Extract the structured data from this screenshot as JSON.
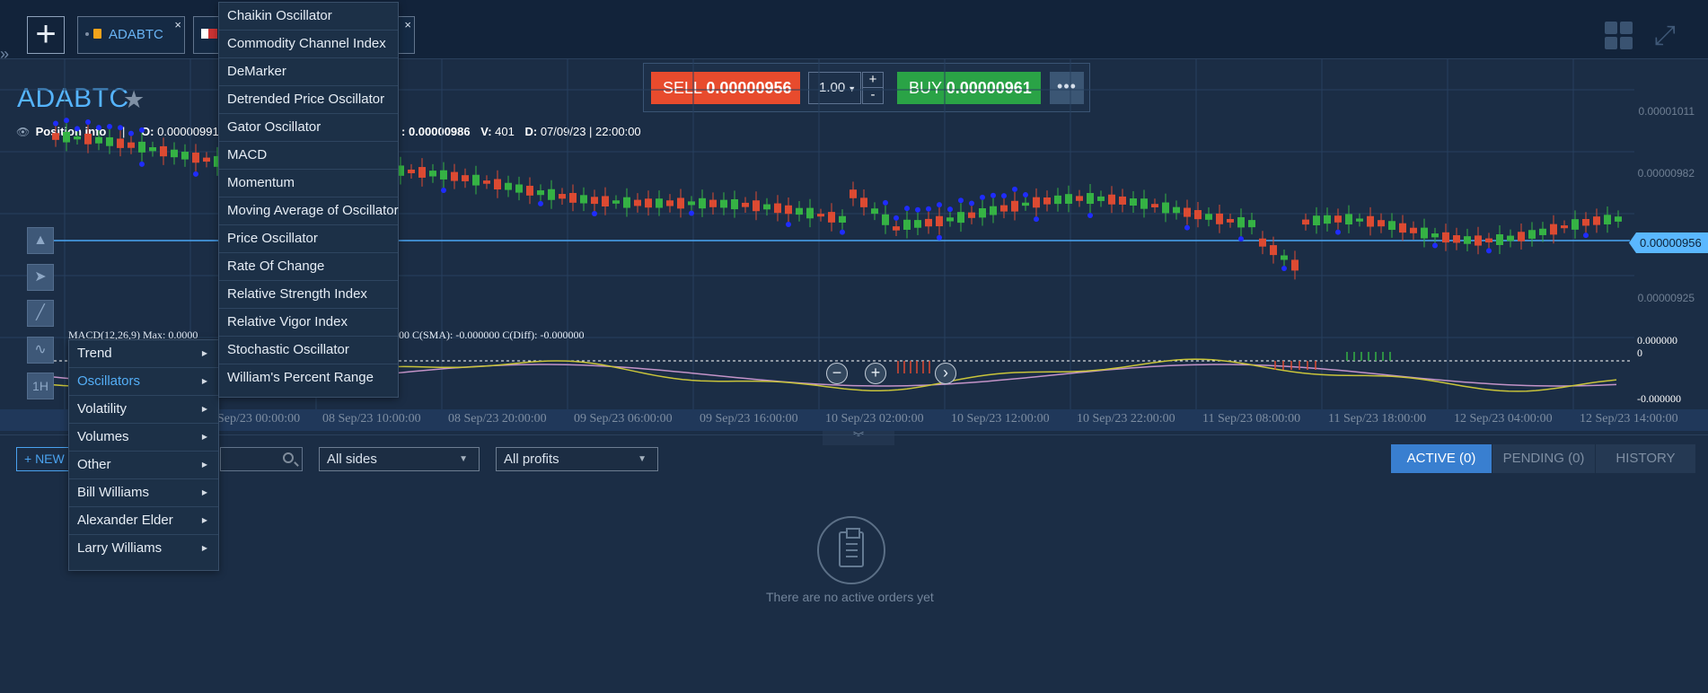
{
  "topbar": {
    "tabs": [
      {
        "label": "ADABTC",
        "close": "×"
      },
      {
        "label": "",
        "close": "×"
      }
    ],
    "add_label": "+"
  },
  "instrument": {
    "symbol": "ADABTC",
    "favorite_icon": "star-icon"
  },
  "info": {
    "position_label": "Position info",
    "sep": "|",
    "open_label": "O:",
    "open_value": "0.00000991",
    "close_fragment": ": 0.00000986",
    "volume_label": "V:",
    "volume_value": "401",
    "date_label": "D:",
    "date_value": "07/09/23 | 22:00:00"
  },
  "trade": {
    "sell_label": "SELL",
    "sell_price": "0.00000956",
    "quantity": "1.00",
    "plus": "+",
    "minus": "-",
    "buy_label": "BUY",
    "buy_price": "0.00000961",
    "more": "•••"
  },
  "price_axis": [
    "0.00001011",
    "0.00000982",
    "0.00000925"
  ],
  "current_price": "0.00000956",
  "macd": {
    "label_left": "MACD(12,26,9) Max: 0.0000",
    "label_right": "0000 C(SMA): -0.000000 C(Diff): -0.000000",
    "zero_top": "0.000000",
    "zero_bottom": "0",
    "neg": "-0.000000"
  },
  "time_axis": [
    "Sep/23 00:00:00",
    "08 Sep/23 10:00:00",
    "08 Sep/23 20:00:00",
    "09 Sep/23 06:00:00",
    "09 Sep/23 16:00:00",
    "10 Sep/23 02:00:00",
    "10 Sep/23 12:00:00",
    "10 Sep/23 22:00:00",
    "11 Sep/23 08:00:00",
    "11 Sep/23 18:00:00",
    "12 Sep/23 04:00:00",
    "12 Sep/23 14:00:00"
  ],
  "tools": {
    "chart_type": "1H"
  },
  "indicator_menu": {
    "categories": [
      "Trend",
      "Oscillators",
      "Volatility",
      "Volumes",
      "Other",
      "Bill Williams",
      "Alexander Elder",
      "Larry Williams"
    ],
    "oscillators": [
      "Chaikin Oscillator",
      "Commodity Channel Index",
      "DeMarker",
      "Detrended Price Oscillator",
      "Gator Oscillator",
      "MACD",
      "Momentum",
      "Moving Average of Oscillator",
      "Price Oscillator",
      "Rate Of Change",
      "Relative Strength Index",
      "Relative Vigor Index",
      "Stochastic Oscillator",
      "William's Percent Range"
    ]
  },
  "orders": {
    "new_button": "+ NEW",
    "side_filter": "All sides",
    "profit_filter": "All profits",
    "tabs": [
      "ACTIVE (0)",
      "PENDING (0)",
      "HISTORY"
    ],
    "empty_text": "There are no active orders yet"
  },
  "colors": {
    "sell": "#e84b2d",
    "buy": "#2aa346",
    "accent": "#55b4ff",
    "bull": "#35b244",
    "bear": "#dc4a32"
  }
}
